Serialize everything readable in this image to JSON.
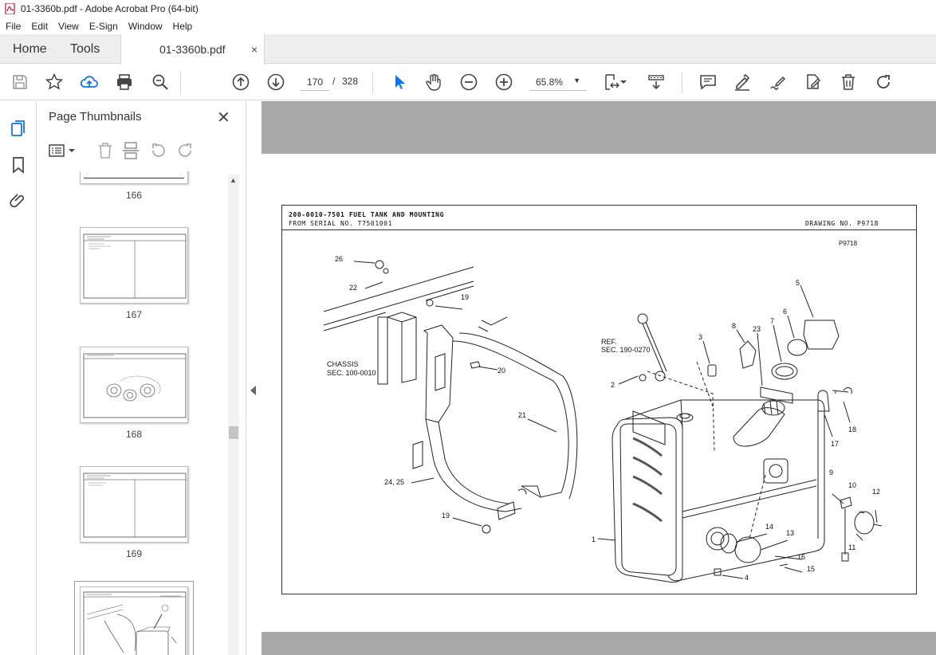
{
  "window": {
    "title": "01-3360b.pdf - Adobe Acrobat Pro (64-bit)"
  },
  "menu": [
    "File",
    "Edit",
    "View",
    "E-Sign",
    "Window",
    "Help"
  ],
  "tabs": {
    "home": "Home",
    "tools": "Tools",
    "document": "01-3360b.pdf",
    "close": "×"
  },
  "toolbar": {
    "current_page": "170",
    "separator": "/",
    "total_pages": "328",
    "zoom": "65.8%"
  },
  "thumbnails": {
    "title": "Page Thumbnails",
    "close": "✕",
    "pages": [
      {
        "label": "166"
      },
      {
        "label": "167"
      },
      {
        "label": "168"
      },
      {
        "label": "169"
      }
    ],
    "selected_page": "170"
  },
  "drawing": {
    "title": "200-0010-7501 FUEL TANK AND MOUNTING",
    "serial": "FROM SERIAL NO. T7501001",
    "drawing_no": "DRAWING NO. P9718",
    "code": "P9718",
    "chassis_note_1": "CHASSIS",
    "chassis_note_2": "SEC. 100-0010",
    "ref_note_1": "REF.",
    "ref_note_2": "SEC. 190-0270",
    "callouts": [
      "26",
      "22",
      "19",
      "20",
      "21",
      "24, 25",
      "19",
      "2",
      "3",
      "8",
      "23",
      "7",
      "6",
      "5",
      "17",
      "18",
      "9",
      "10",
      "12",
      "11",
      "14",
      "13",
      "16",
      "15",
      "1",
      "4"
    ]
  }
}
